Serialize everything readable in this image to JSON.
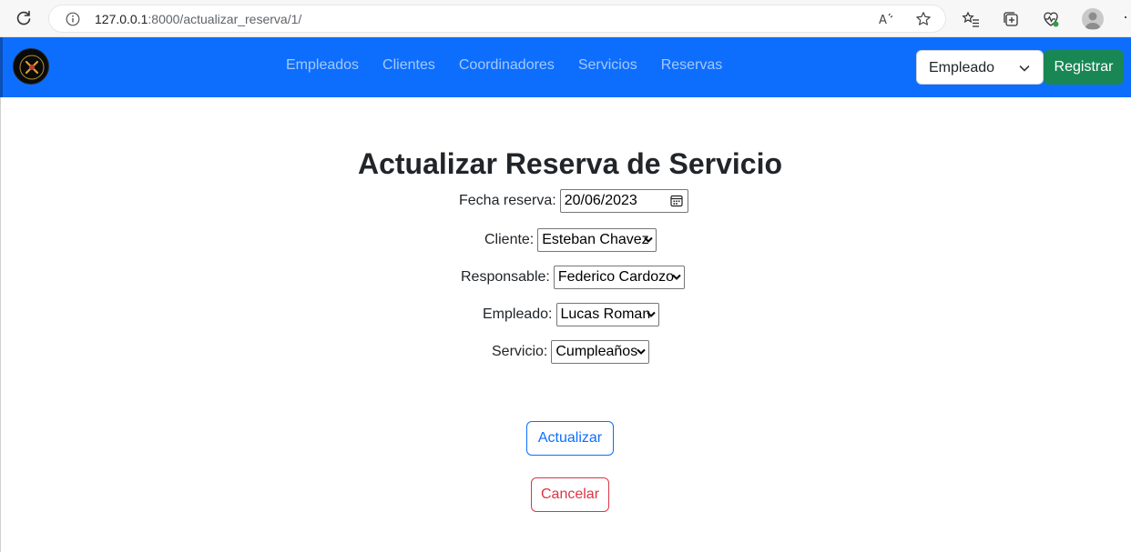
{
  "browser": {
    "url_host": "127.0.0.1",
    "url_rest": ":8000/actualizar_reserva/1/",
    "more_label": "···"
  },
  "navbar": {
    "links": [
      "Empleados",
      "Clientes",
      "Coordinadores",
      "Servicios",
      "Reservas"
    ],
    "role_select": "Empleado",
    "register_label": "Registrar",
    "colors": {
      "navbar": "#0d6efd",
      "register": "#198754"
    }
  },
  "form": {
    "title": "Actualizar Reserva de Servicio",
    "fecha_label": "Fecha reserva:",
    "fecha_value": "20/06/2023",
    "cliente_label": "Cliente:",
    "cliente_value": "Esteban Chavez",
    "responsable_label": "Responsable:",
    "responsable_value": "Federico Cardozo",
    "empleado_label": "Empleado:",
    "empleado_value": "Lucas Roman",
    "servicio_label": "Servicio:",
    "servicio_value": "Cumpleaños",
    "update_label": "Actualizar",
    "cancel_label": "Cancelar",
    "colors": {
      "update": "#0d6efd",
      "cancel": "#dc3545"
    }
  }
}
